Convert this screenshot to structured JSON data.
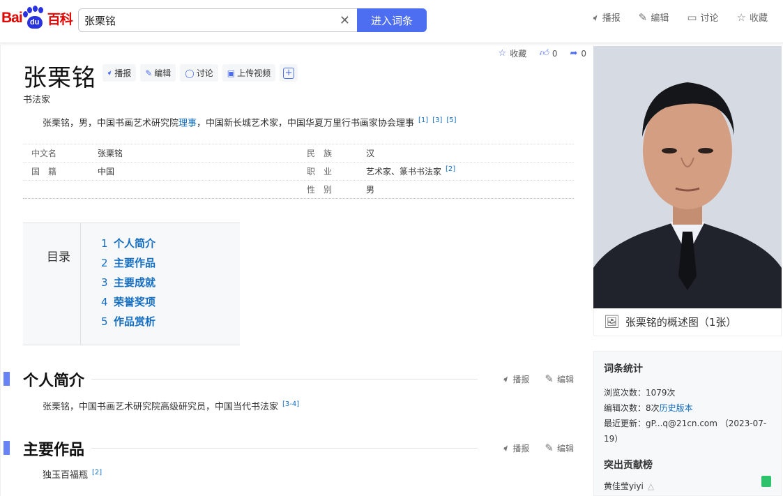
{
  "header": {
    "logo_text_left": "Bai",
    "logo_text_paw": "du",
    "logo_text_right": "百科",
    "search_value": "张栗铭",
    "search_button": "进入词条",
    "tools": [
      {
        "label": "播报",
        "icon": "speaker-icon"
      },
      {
        "label": "编辑",
        "icon": "pencil-icon"
      },
      {
        "label": "讨论",
        "icon": "chat-icon"
      },
      {
        "label": "收藏",
        "icon": "star-icon"
      }
    ]
  },
  "social": {
    "favorite_label": "收藏",
    "like_count": "0",
    "share_count": "0"
  },
  "entry": {
    "title": "张栗铭",
    "buttons": [
      "播报",
      "编辑",
      "讨论",
      "上传视频"
    ],
    "subtitle": "书法家",
    "summary_pre": "张栗铭，男，中国书画艺术研究院",
    "summary_link": "理事",
    "summary_post": "，中国新长城艺术家，中国华夏万里行书画家协会理事",
    "summary_refs": [
      "[1]",
      "[3]",
      "[5]"
    ]
  },
  "info": {
    "rows": [
      {
        "k1": "中文名",
        "v1": "张栗铭",
        "k2": "民　族",
        "v2": "汉",
        "ref2": ""
      },
      {
        "k1": "国　籍",
        "v1": "中国",
        "k2": "职　业",
        "v2": "艺术家、篆书书法家",
        "ref2": "[2]"
      },
      {
        "k1": "",
        "v1": "",
        "k2": "性　别",
        "v2": "男",
        "ref2": ""
      }
    ]
  },
  "toc": {
    "label": "目录",
    "items": [
      {
        "num": "1",
        "label": "个人简介"
      },
      {
        "num": "2",
        "label": "主要作品"
      },
      {
        "num": "3",
        "label": "主要成就"
      },
      {
        "num": "4",
        "label": "荣誉奖项"
      },
      {
        "num": "5",
        "label": "作品赏析"
      }
    ]
  },
  "sections": [
    {
      "title": "个人简介",
      "play": "播报",
      "edit": "编辑",
      "text": "张栗铭，中国书画艺术研究院高级研究员，中国当代书法家",
      "ref": "[3-4]"
    },
    {
      "title": "主要作品",
      "play": "播报",
      "edit": "编辑",
      "text": "独玉百福瓶",
      "ref": "[2]"
    }
  ],
  "sidebar": {
    "photo_caption": "张栗铭的概述图（1张）",
    "stats_title": "词条统计",
    "views": "浏览次数：1079次",
    "edits_pre": "编辑次数：8次",
    "edits_link": "历史版本",
    "updated": "最近更新：gP...q@21cn.com （2023-07-19）",
    "contrib_title": "突出贡献榜",
    "contributor": "黄佳莹yiyi"
  },
  "colors": {
    "brand_blue": "#4e6ef2",
    "link": "#136ec2",
    "brand_red": "#e10601"
  }
}
